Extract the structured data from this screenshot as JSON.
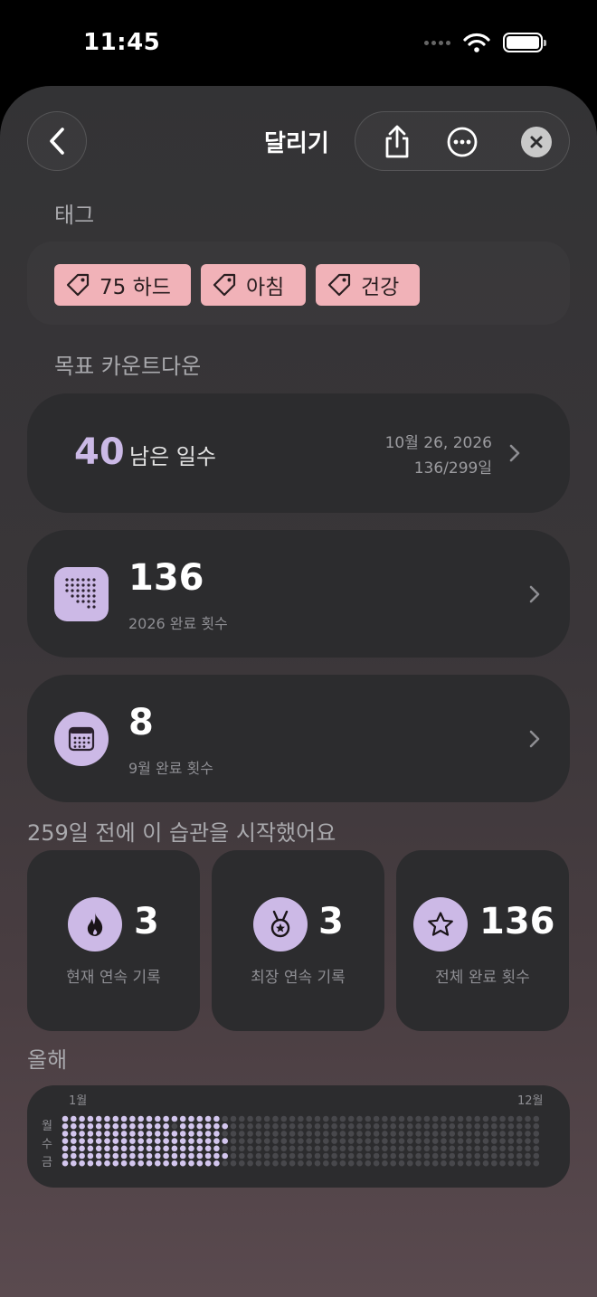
{
  "status": {
    "time": "11:45"
  },
  "header": {
    "title": "달리기",
    "back_icon": "chevron-left-icon",
    "share_icon": "share-icon",
    "more_icon": "ellipsis-circle-icon",
    "close_icon": "close-icon"
  },
  "tags_section": {
    "title": "태그",
    "tags": [
      {
        "label": "75 하드",
        "icon": "tag-icon"
      },
      {
        "label": "아침",
        "icon": "tag-icon"
      },
      {
        "label": "건강",
        "icon": "tag-icon"
      }
    ]
  },
  "goal_section": {
    "title": "목표 카운트다운",
    "days_left": "40",
    "days_left_label": "남은 일수",
    "target_date": "10월 26, 2026",
    "progress": "136/299일"
  },
  "yearly_stat": {
    "value": "136",
    "label": "2026 완료 횟수",
    "icon": "dot-grid-icon"
  },
  "monthly_stat": {
    "value": "8",
    "label": "9월 완료 횟수",
    "icon": "calendar-icon"
  },
  "started_text": "259일 전에 이 습관을 시작했어요",
  "mini_stats": [
    {
      "value": "3",
      "label": "현재 연속 기록",
      "icon": "flame-icon"
    },
    {
      "value": "3",
      "label": "최장 연속 기록",
      "icon": "medal-icon"
    },
    {
      "value": "136",
      "label": "전체 완료 횟수",
      "icon": "star-icon"
    }
  ],
  "this_year": {
    "title": "올해",
    "month_start": "1월",
    "month_end": "12월",
    "weekdays": [
      "월",
      "수",
      "금"
    ],
    "completed_days": 136,
    "colors": {
      "done": "#d3c6ee",
      "empty": "#48484c"
    }
  },
  "colors": {
    "accent": "#ccb9e6",
    "tag_bg": "#f1b2b8",
    "card_bg": "#2c2c2e",
    "countdown_number": "#cbb9e6"
  }
}
